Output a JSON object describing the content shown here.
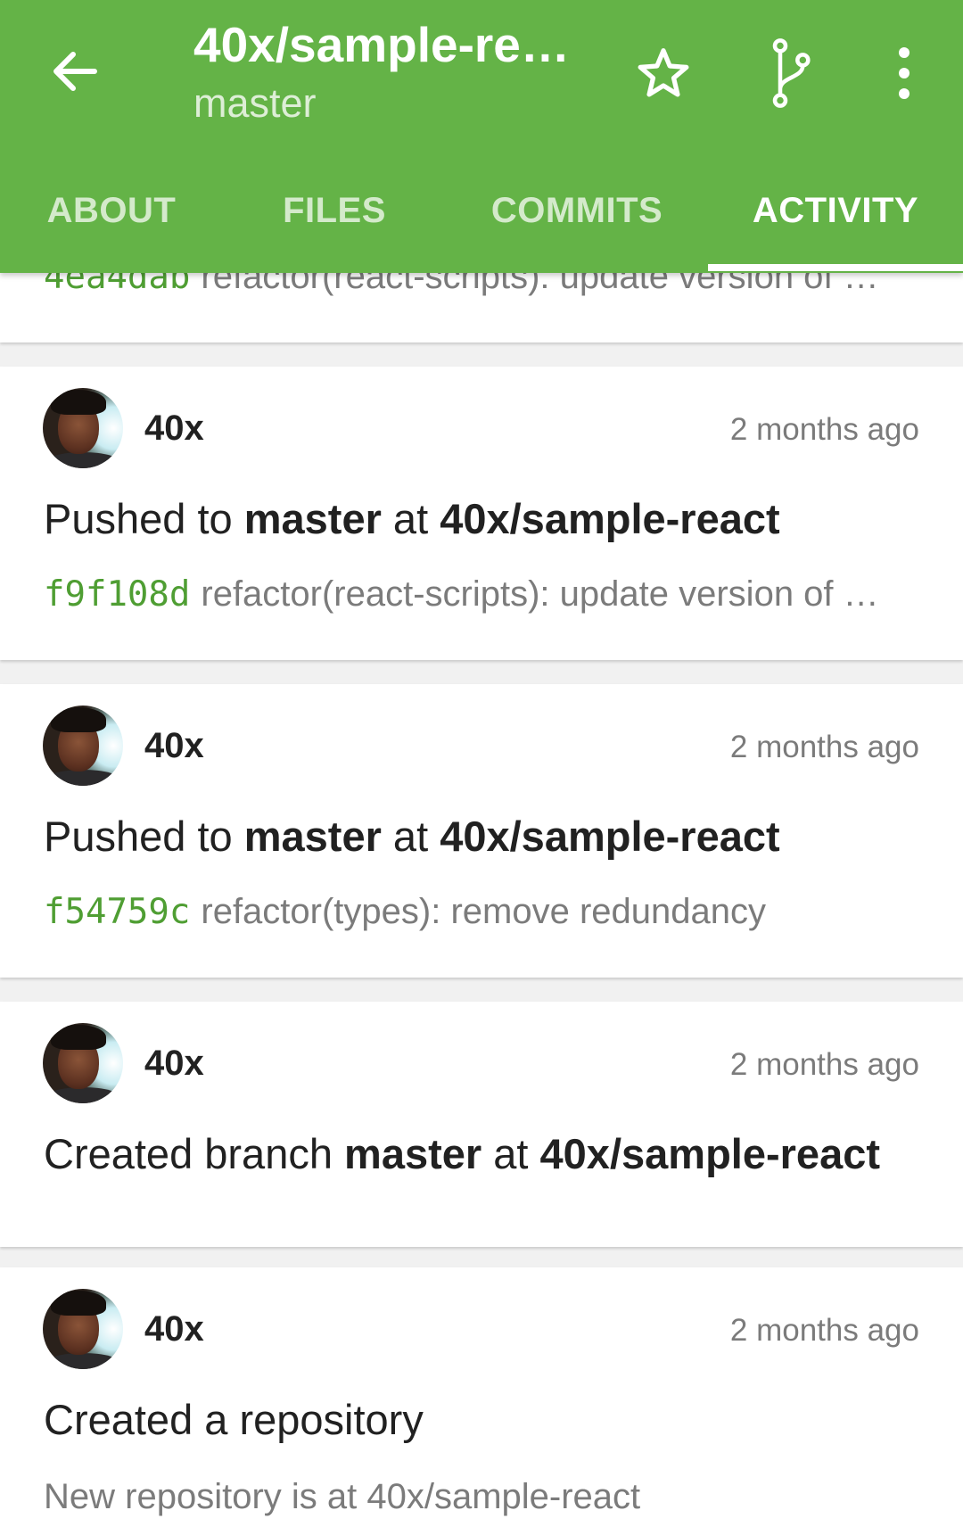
{
  "appbar": {
    "title": "40x/sample-re…",
    "subtitle": "master",
    "back_icon": "arrow-left-icon",
    "actions": [
      {
        "icon": "star-outline-icon"
      },
      {
        "icon": "git-branch-icon"
      },
      {
        "icon": "more-vert-icon"
      }
    ],
    "color": "#64b347"
  },
  "tabs": [
    {
      "label": "ABOUT"
    },
    {
      "label": "FILES"
    },
    {
      "label": "COMMITS"
    },
    {
      "label": "ACTIVITY",
      "active": true
    }
  ],
  "feed": [
    {
      "partial": true,
      "sha": "4ea4dab",
      "message": "refactor(react-scripts): update version of …"
    },
    {
      "user": "40x",
      "time": "2 months ago",
      "action_prefix": "Pushed to ",
      "target": "master",
      "action_mid": " at ",
      "repo": "40x/sample-react",
      "sha": "f9f108d",
      "message": "refactor(react-scripts): update version of …"
    },
    {
      "user": "40x",
      "time": "2 months ago",
      "action_prefix": "Pushed to ",
      "target": "master",
      "action_mid": " at ",
      "repo": "40x/sample-react",
      "sha": "f54759c",
      "message": "refactor(types): remove redundancy"
    },
    {
      "user": "40x",
      "time": "2 months ago",
      "action_prefix": "Created branch ",
      "target": "master",
      "action_mid": " at ",
      "repo": "40x/sample-react"
    },
    {
      "user": "40x",
      "time": "2 months ago",
      "action_text": "Created a repository",
      "detail": "New repository is at 40x/sample-react"
    }
  ],
  "colors": {
    "sha": "#4f9e33",
    "secondary_text": "#7b7b7b",
    "primary_text": "#212121"
  }
}
